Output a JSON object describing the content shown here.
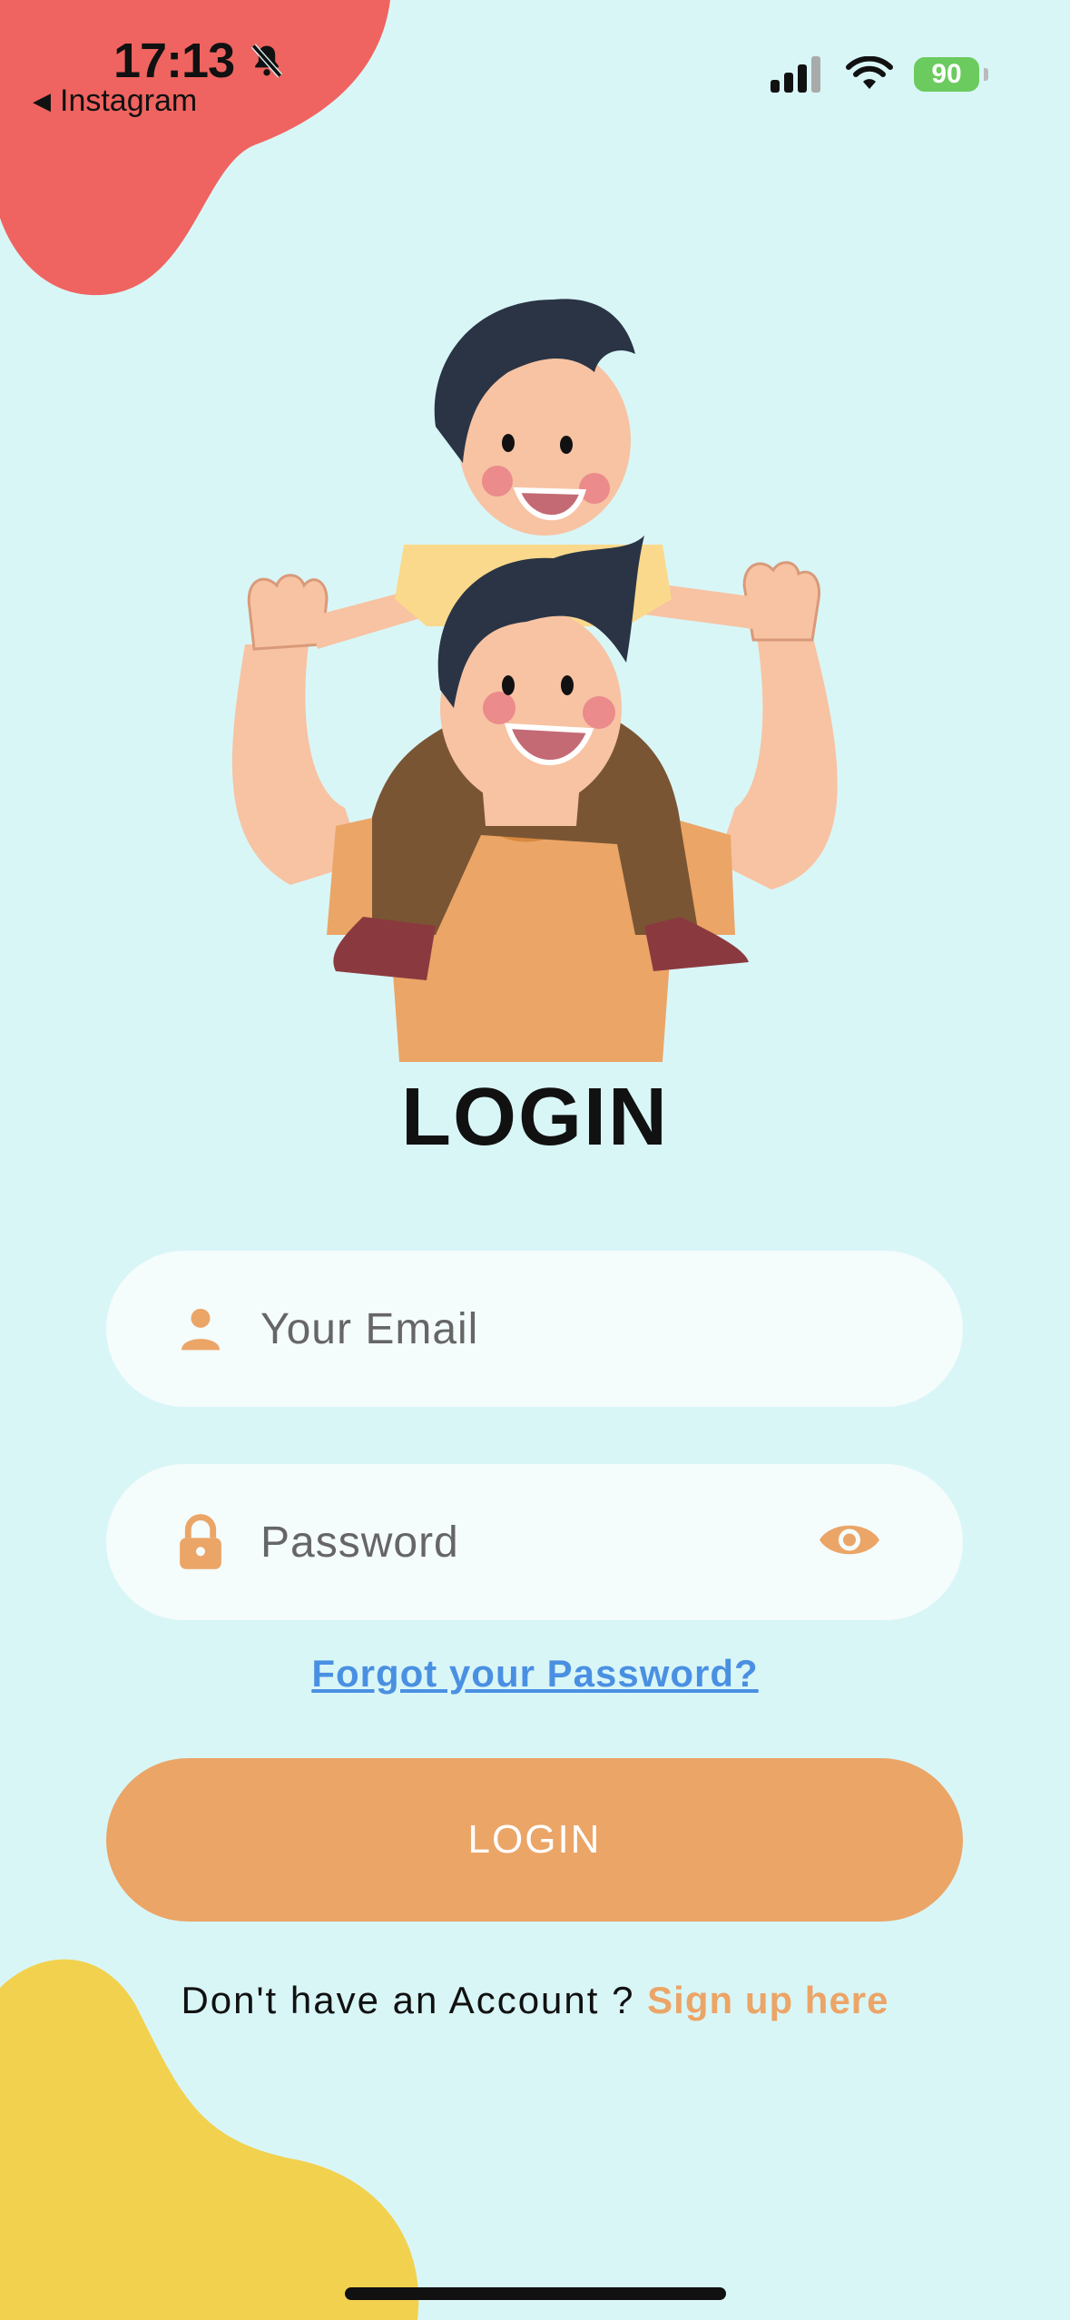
{
  "status_bar": {
    "time": "17:13",
    "back_app": "Instagram",
    "battery": "90"
  },
  "login": {
    "title": "LOGIN",
    "email_placeholder": "Your Email",
    "password_placeholder": "Password",
    "forgot_link": "Forgot your Password?",
    "login_button": "LOGIN",
    "signup_prompt": "Don't have an Account ?",
    "signup_link": "Sign up here"
  },
  "icons": [
    "mute-bell-icon",
    "back-arrow-icon",
    "signal-icon",
    "wifi-icon",
    "battery-icon",
    "user-icon",
    "lock-icon",
    "eye-icon"
  ],
  "colors": {
    "background": "#D9F6F7",
    "accent": "#EBA567",
    "link": "#4A90E2",
    "blob_red": "#EF6460",
    "blob_yellow": "#F2D14E"
  }
}
